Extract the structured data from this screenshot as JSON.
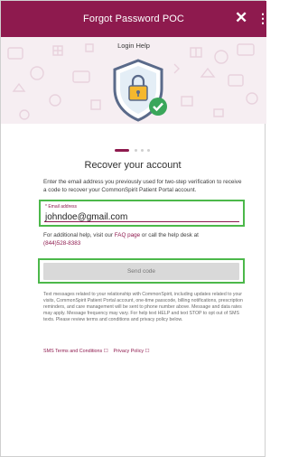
{
  "header": {
    "title": "Forgot Password POC",
    "close_label": "✕",
    "menu_label": "⋮"
  },
  "hero": {
    "subtitle": "Login Help",
    "shield_icon": "shield-lock-check-icon"
  },
  "pager": {
    "total": 4,
    "active": 1
  },
  "main": {
    "heading": "Recover your account",
    "intro": "Enter the email address you previously used for two-step verification to receive a code to recover your CommonSpirit Patient Portal account.",
    "email_field": {
      "label": "* Email address",
      "value": "johndoe@gmail.com"
    },
    "help_prefix": "For additional help, visit our ",
    "faq_link": "FAQ page",
    "help_middle": " or call the help desk at ",
    "phone": "(844)528-8383",
    "send_button": "Send code",
    "legal_text": "Text messages related to your relationship with CommonSpirit, including updates related to your visits, CommonSpirit Patient Portal account, one-time passcode, billing notifications, prescription reminders, and care management will be sent to phone number above. Message and data rates may apply. Message frequency may vary. For help text HELP and text STOP to opt out of SMS texts. Please review terms and conditions and privacy policy below.",
    "sms_terms": "SMS Terms and Conditions ☐",
    "privacy": "Privacy Policy ☐"
  },
  "colors": {
    "brand": "#8e1a4e",
    "highlight": "#4cb84a"
  }
}
